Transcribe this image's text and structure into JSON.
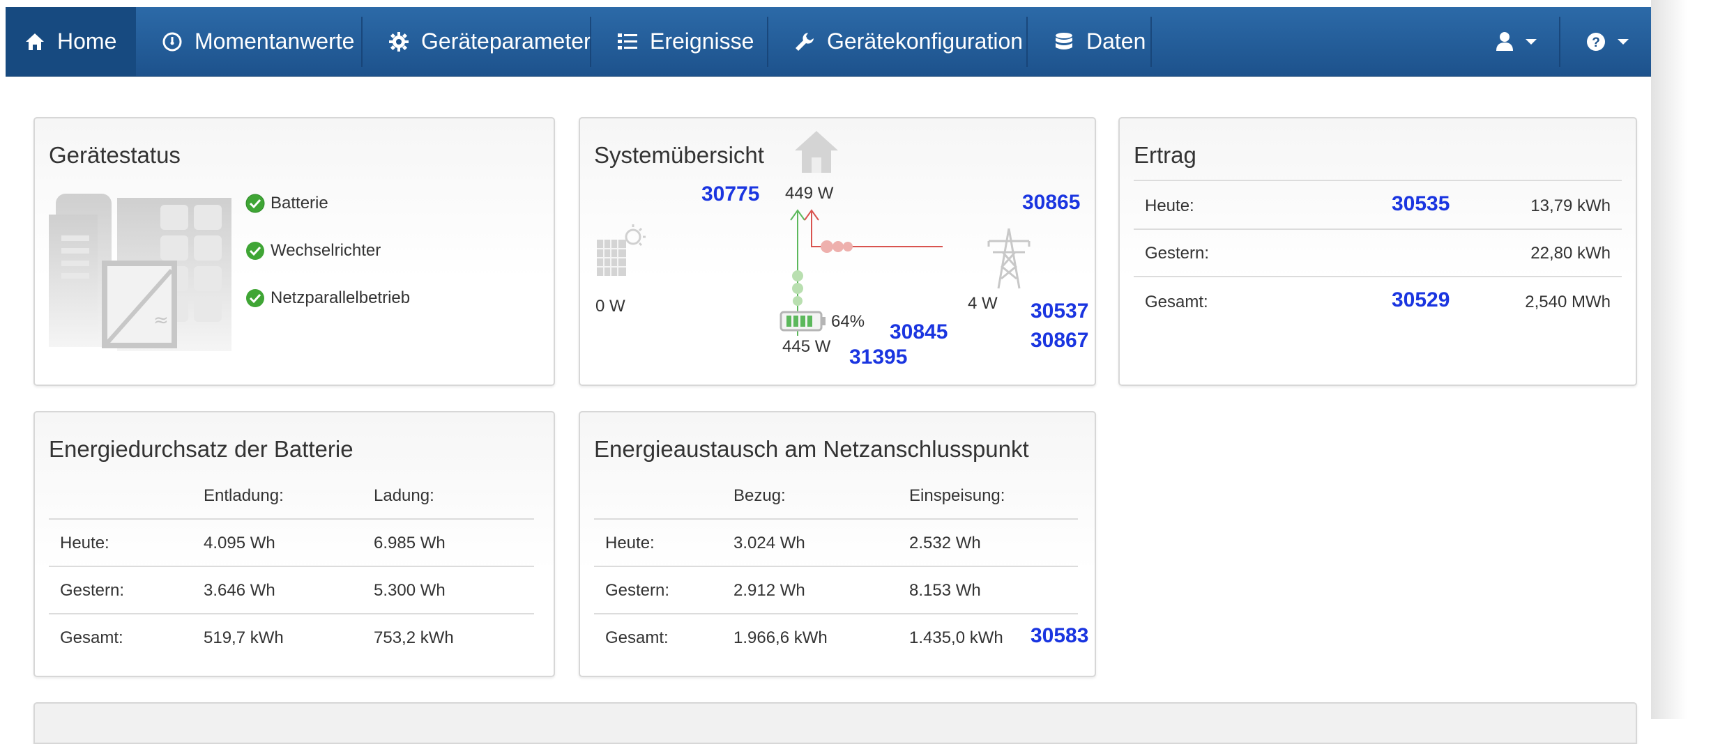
{
  "nav": {
    "items": [
      {
        "label": "Home",
        "icon": "home-icon"
      },
      {
        "label": "Momentanwerte",
        "icon": "gauge-icon"
      },
      {
        "label": "Geräteparameter",
        "icon": "gear-icon"
      },
      {
        "label": "Ereignisse",
        "icon": "list-icon"
      },
      {
        "label": "Gerätekonfiguration",
        "icon": "wrench-icon"
      },
      {
        "label": "Daten",
        "icon": "database-icon"
      }
    ],
    "user_icon": "user-icon",
    "help_icon": "help-icon"
  },
  "status_panel": {
    "title": "Gerätestatus",
    "items": [
      "Batterie",
      "Wechselrichter",
      "Netzparallelbetrieb"
    ]
  },
  "system_panel": {
    "title": "Systemübersicht",
    "pv_power": "0 W",
    "house_power": "449 W",
    "grid_power": "4 W",
    "battery_power": "445 W",
    "battery_soc": "64%",
    "refs": {
      "r30775": "30775",
      "r30865": "30865",
      "r30537": "30537",
      "r30867": "30867",
      "r30845": "30845",
      "r31395": "31395"
    }
  },
  "yield_panel": {
    "title": "Ertrag",
    "rows": [
      {
        "label": "Heute:",
        "ref": "30535",
        "value": "13,79 kWh"
      },
      {
        "label": "Gestern:",
        "ref": "",
        "value": "22,80 kWh"
      },
      {
        "label": "Gesamt:",
        "ref": "30529",
        "value": "2,540 MWh"
      }
    ]
  },
  "battery_panel": {
    "title": "Energiedurchsatz der Batterie",
    "headers": [
      "Entladung:",
      "Ladung:"
    ],
    "rows": [
      {
        "label": "Heute:",
        "a": "4.095 Wh",
        "b": "6.985 Wh"
      },
      {
        "label": "Gestern:",
        "a": "3.646 Wh",
        "b": "5.300 Wh"
      },
      {
        "label": "Gesamt:",
        "a": "519,7 kWh",
        "b": "753,2 kWh"
      }
    ]
  },
  "grid_panel": {
    "title": "Energieaustausch am Netzanschlusspunkt",
    "headers": [
      "Bezug:",
      "Einspeisung:"
    ],
    "rows": [
      {
        "label": "Heute:",
        "a": "3.024 Wh",
        "b": "2.532 Wh"
      },
      {
        "label": "Gestern:",
        "a": "2.912 Wh",
        "b": "8.153 Wh"
      },
      {
        "label": "Gesamt:",
        "a": "1.966,6 kWh",
        "b": "1.435,0 kWh"
      }
    ],
    "ref": "30583"
  },
  "colors": {
    "nav_bg": "#1d528c",
    "accent_blue": "#1a35e0",
    "ok_green": "#3fa535",
    "flow_red": "#d9534f",
    "flow_green": "#5cb85c"
  }
}
